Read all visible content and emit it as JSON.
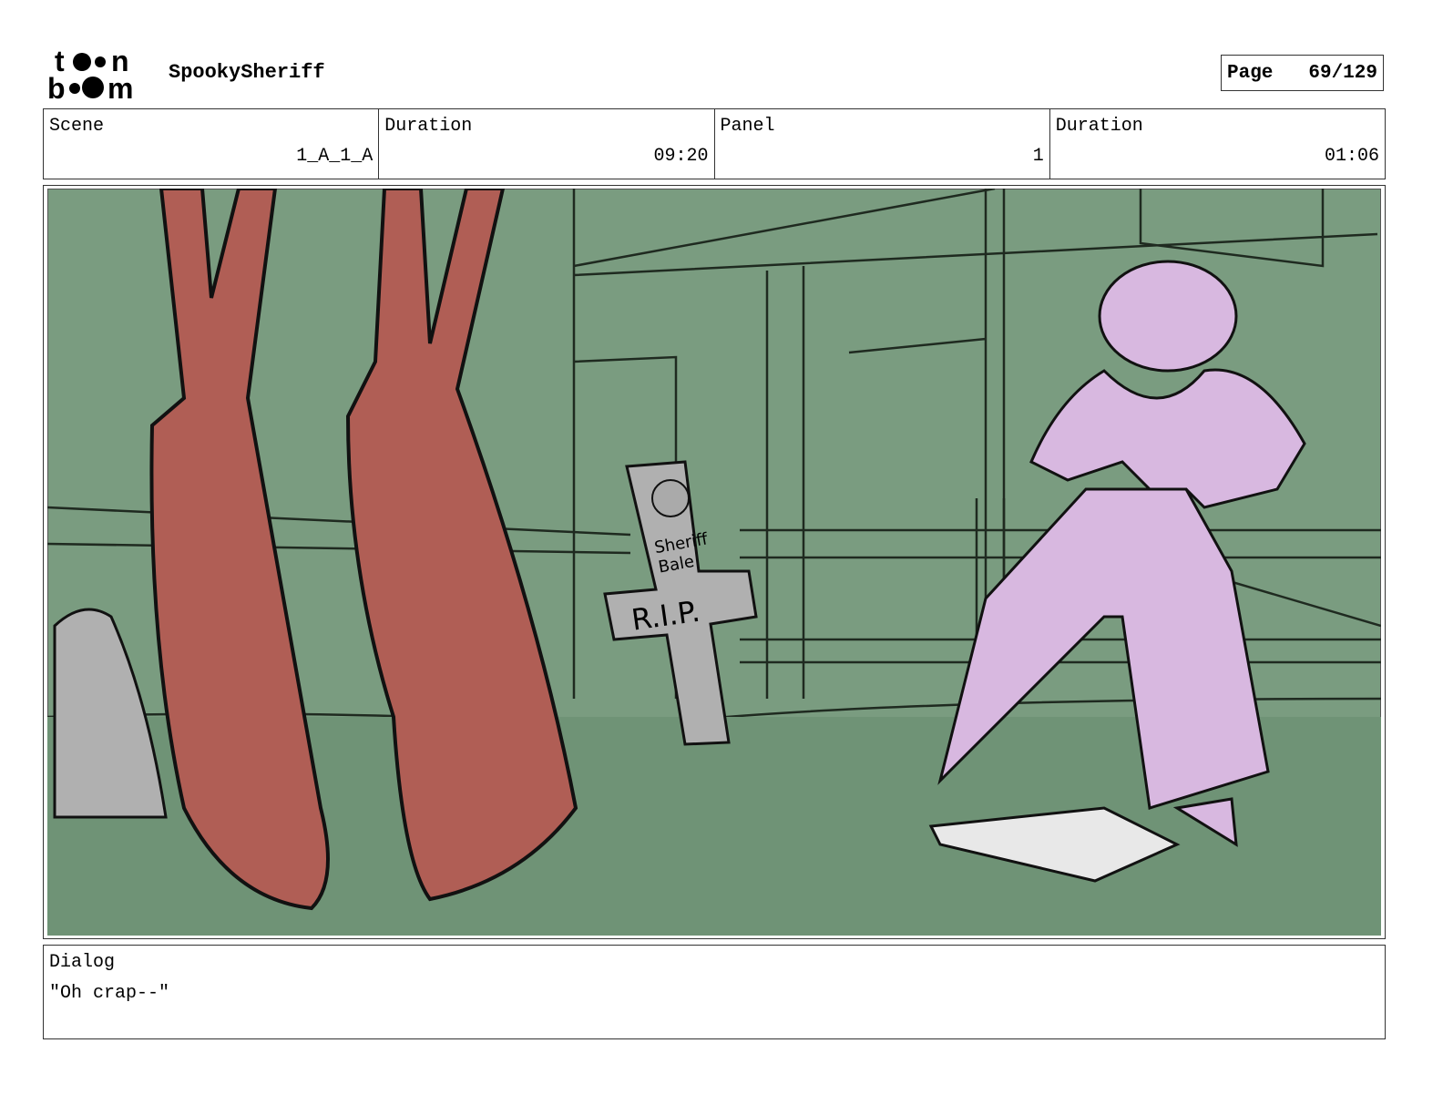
{
  "header": {
    "logo_text": "toon boom",
    "project": "SpookySheriff",
    "page_label": "Page",
    "page_value": "69/129"
  },
  "info": {
    "scene_label": "Scene",
    "scene_value": "1_A_1_A",
    "scene_duration_label": "Duration",
    "scene_duration_value": "09:20",
    "panel_label": "Panel",
    "panel_value": "1",
    "panel_duration_label": "Duration",
    "panel_duration_value": "01:06"
  },
  "panel_art": {
    "tombstone_text": [
      "Sheriff",
      "Bale",
      "R.I.P."
    ],
    "colors": {
      "background": "#7a9c80",
      "feet": "#b05e55",
      "character": "#d8b8e0",
      "stone": "#b0b0b0"
    }
  },
  "dialog": {
    "label": "Dialog",
    "text": "\"Oh crap--\""
  }
}
